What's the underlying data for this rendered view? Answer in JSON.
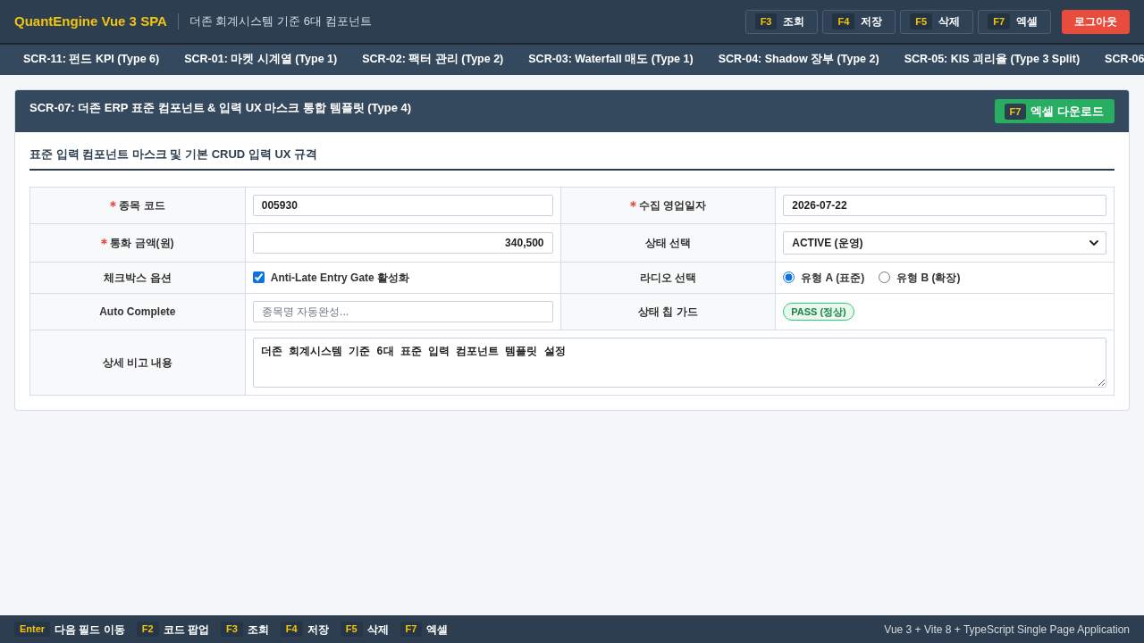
{
  "header": {
    "title": "QuantEngine Vue 3 SPA",
    "subtitle": "더존 회계시스템 기준 6대 컴포넌트",
    "actions": [
      {
        "kind": "function",
        "key": "F3",
        "label": "조회"
      },
      {
        "kind": "function",
        "key": "F4",
        "label": "저장"
      },
      {
        "kind": "function",
        "key": "F5",
        "label": "삭제"
      },
      {
        "kind": "function",
        "key": "F7",
        "label": "엑셀"
      },
      {
        "kind": "logout",
        "label": "로그아웃"
      }
    ]
  },
  "tabs": [
    {
      "label": "SCR-11: 펀드 KPI (Type 6)",
      "selected": false
    },
    {
      "label": "SCR-01: 마켓 시계열 (Type 1)",
      "selected": false
    },
    {
      "label": "SCR-02: 팩터 관리 (Type 2)",
      "selected": false
    },
    {
      "label": "SCR-03: Waterfall 매도 (Type 1)",
      "selected": false
    },
    {
      "label": "SCR-04: Shadow 장부 (Type 2)",
      "selected": false
    },
    {
      "label": "SCR-05: KIS 괴리율 (Type 3 Split)",
      "selected": false
    },
    {
      "label": "SCR-06",
      "selected": false
    }
  ],
  "panel": {
    "title": "SCR-07: 더존 ERP 표준 컴포넌트 & 입력 UX 마스크 통합 템플릿 (Type 4)",
    "export_button": {
      "key": "F7",
      "label": "엑셀 다운로드"
    },
    "section_title": "표준 입력 컴포넌트 마스크 및 기본 CRUD 입력 UX 규격",
    "rows": [
      [
        {
          "label": "종목 코드",
          "required": true,
          "kind": "text",
          "value": "005930"
        },
        {
          "label": "수집 영업일자",
          "required": true,
          "kind": "date",
          "value": "2026-07-22"
        }
      ],
      [
        {
          "label": "통화 금액(원)",
          "required": true,
          "kind": "amount",
          "value": "340,500"
        },
        {
          "label": "상태 선택",
          "required": false,
          "kind": "select",
          "value": "ACTIVE (운영)"
        }
      ],
      [
        {
          "label": "체크박스 옵션",
          "required": false,
          "kind": "checkbox",
          "text": "Anti-Late Entry Gate 활성화",
          "checked": true
        },
        {
          "label": "라디오 선택",
          "required": false,
          "kind": "radio",
          "options": [
            {
              "label": "유형 A (표준)",
              "selected": true
            },
            {
              "label": "유형 B (확장)",
              "selected": false
            }
          ]
        }
      ],
      [
        {
          "label": "Auto Complete",
          "required": false,
          "kind": "autocomplete",
          "placeholder": "종목명 자동완성..."
        },
        {
          "label": "상태 칩 가드",
          "required": false,
          "kind": "chip",
          "text": "PASS (정상)"
        }
      ],
      [
        {
          "label": "상세 비고 내용",
          "required": false,
          "kind": "textarea",
          "value": "더존 회계시스템 기준 6대 표준 입력 컴포넌트 템플릿 설정"
        }
      ]
    ]
  },
  "footer": {
    "hints": [
      {
        "key": "Enter",
        "label": "다음 필드 이동"
      },
      {
        "key": "F2",
        "label": "코드 팝업"
      },
      {
        "key": "F3",
        "label": "조회"
      },
      {
        "key": "F4",
        "label": "저장"
      },
      {
        "key": "F5",
        "label": "삭제"
      },
      {
        "key": "F7",
        "label": "엑셀"
      }
    ],
    "info": "Vue 3 + Vite 8 + TypeScript Single Page Application"
  }
}
